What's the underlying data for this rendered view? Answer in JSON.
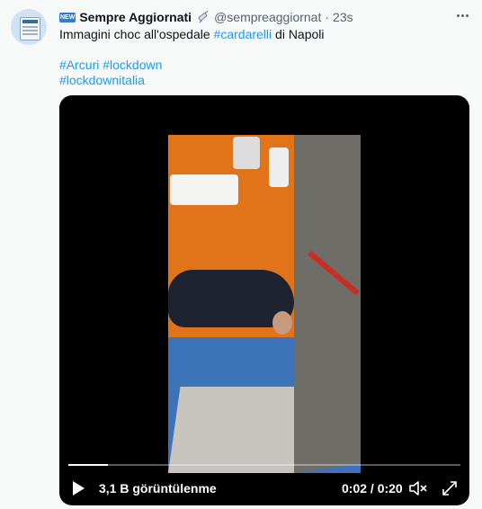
{
  "tweet": {
    "badge": "NEW",
    "display_name": "Sempre Aggiornati",
    "handle": "@sempreaggiornat",
    "separator": "·",
    "time": "23s",
    "text_before": "Immagini choc all'ospedale ",
    "hashtag_inline": "#cardarelli",
    "text_after": " di Napoli",
    "hashtags_line1": [
      "#Arcuri",
      "#lockdown"
    ],
    "hashtags_line2": [
      "#lockdownitalia"
    ],
    "colors": {
      "hashtag": "#1d9bf0",
      "background": "#f7f9f9",
      "muted": "#536471"
    }
  },
  "video": {
    "views": "3,1 B görüntülenme",
    "timecode": "0:02 / 0:20",
    "progress": 0.1,
    "icons": [
      "play-icon",
      "volume-icon",
      "fullscreen-icon"
    ]
  }
}
